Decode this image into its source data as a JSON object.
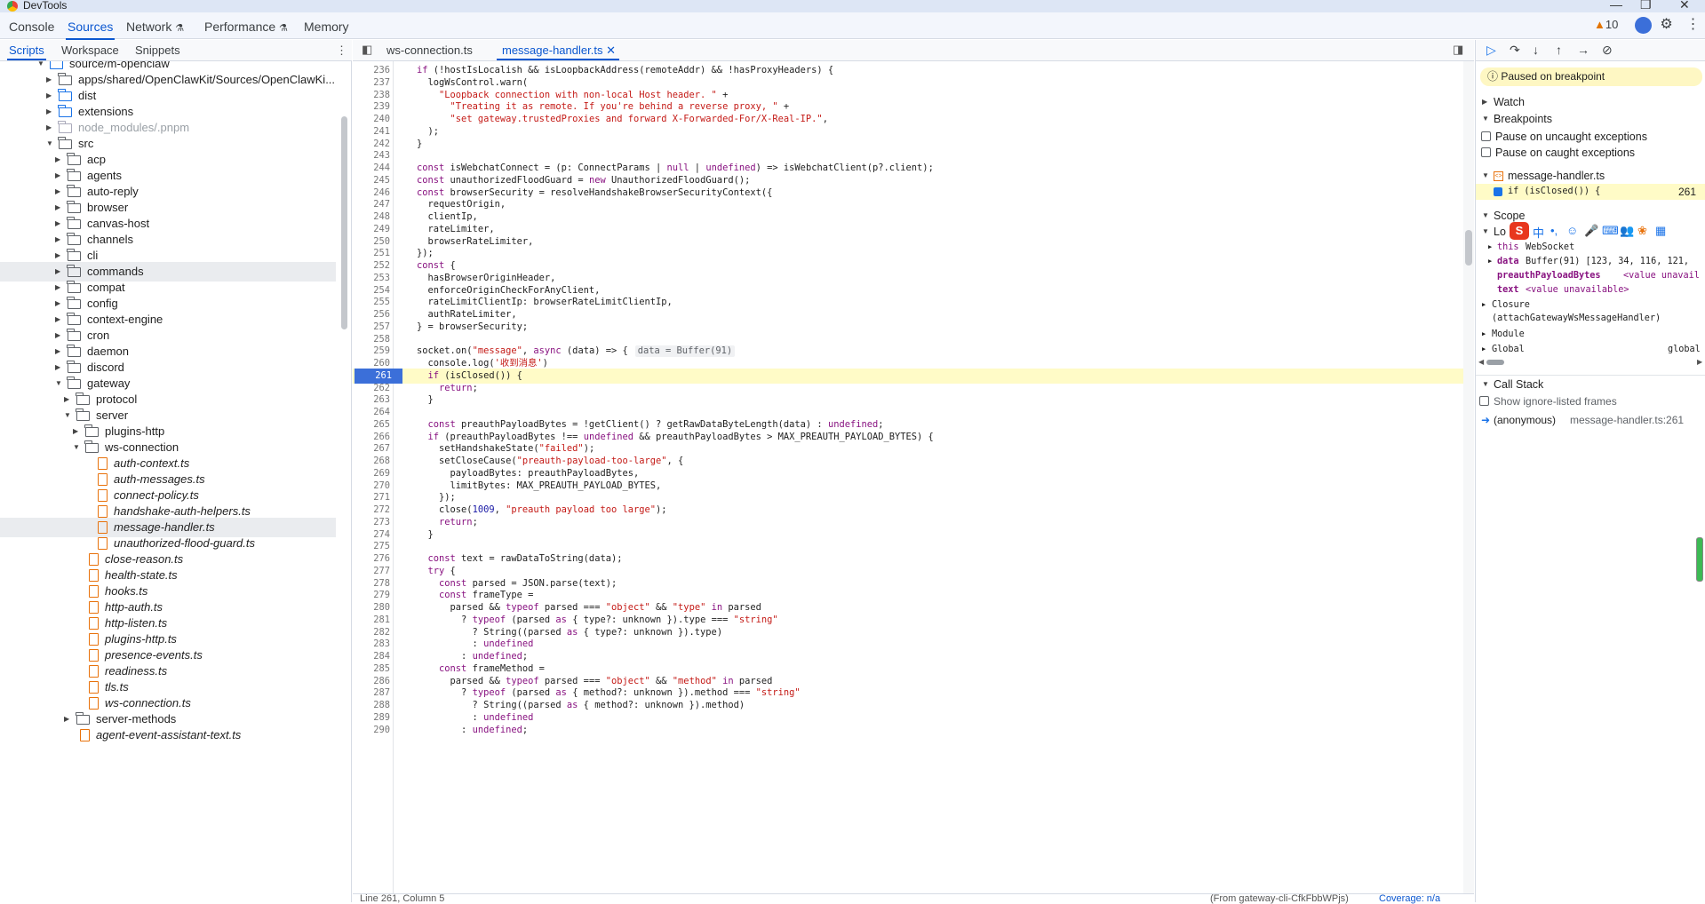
{
  "window": {
    "title": "DevTools"
  },
  "main_tabs": [
    "Console",
    "Sources",
    "Network",
    "Performance",
    "Memory"
  ],
  "issues_count": "10",
  "navigator": {
    "tabs": [
      "Scripts",
      "Workspace",
      "Snippets"
    ],
    "tree": [
      {
        "label": "source/m-openclaw",
        "type": "folder",
        "depth": 2,
        "open": true,
        "color": "blue"
      },
      {
        "label": "apps/shared/OpenClawKit/Sources/OpenClawKi...",
        "type": "folder",
        "depth": 3,
        "open": false
      },
      {
        "label": "dist",
        "type": "folder",
        "depth": 3,
        "open": false,
        "color": "blue"
      },
      {
        "label": "extensions",
        "type": "folder",
        "depth": 3,
        "open": false,
        "color": "blue"
      },
      {
        "label": "node_modules/.pnpm",
        "type": "folder",
        "depth": 3,
        "open": false,
        "color": "gray",
        "dim": true
      },
      {
        "label": "src",
        "type": "folder",
        "depth": 3,
        "open": true
      },
      {
        "label": "acp",
        "type": "folder",
        "depth": 4
      },
      {
        "label": "agents",
        "type": "folder",
        "depth": 4
      },
      {
        "label": "auto-reply",
        "type": "folder",
        "depth": 4
      },
      {
        "label": "browser",
        "type": "folder",
        "depth": 4
      },
      {
        "label": "canvas-host",
        "type": "folder",
        "depth": 4
      },
      {
        "label": "channels",
        "type": "folder",
        "depth": 4
      },
      {
        "label": "cli",
        "type": "folder",
        "depth": 4
      },
      {
        "label": "commands",
        "type": "folder",
        "depth": 4,
        "selected": true
      },
      {
        "label": "compat",
        "type": "folder",
        "depth": 4
      },
      {
        "label": "config",
        "type": "folder",
        "depth": 4
      },
      {
        "label": "context-engine",
        "type": "folder",
        "depth": 4
      },
      {
        "label": "cron",
        "type": "folder",
        "depth": 4
      },
      {
        "label": "daemon",
        "type": "folder",
        "depth": 4
      },
      {
        "label": "discord",
        "type": "folder",
        "depth": 4
      },
      {
        "label": "gateway",
        "type": "folder",
        "depth": 4,
        "open": true
      },
      {
        "label": "protocol",
        "type": "folder",
        "depth": 5
      },
      {
        "label": "server",
        "type": "folder",
        "depth": 5,
        "open": true
      },
      {
        "label": "plugins-http",
        "type": "folder",
        "depth": 6
      },
      {
        "label": "ws-connection",
        "type": "folder",
        "depth": 6,
        "open": true
      },
      {
        "label": "auth-context.ts",
        "type": "file",
        "depth": 7
      },
      {
        "label": "auth-messages.ts",
        "type": "file",
        "depth": 7
      },
      {
        "label": "connect-policy.ts",
        "type": "file",
        "depth": 7
      },
      {
        "label": "handshake-auth-helpers.ts",
        "type": "file",
        "depth": 7
      },
      {
        "label": "message-handler.ts",
        "type": "file",
        "depth": 7,
        "selected": true
      },
      {
        "label": "unauthorized-flood-guard.ts",
        "type": "file",
        "depth": 7
      },
      {
        "label": "close-reason.ts",
        "type": "file",
        "depth": 6
      },
      {
        "label": "health-state.ts",
        "type": "file",
        "depth": 6
      },
      {
        "label": "hooks.ts",
        "type": "file",
        "depth": 6
      },
      {
        "label": "http-auth.ts",
        "type": "file",
        "depth": 6
      },
      {
        "label": "http-listen.ts",
        "type": "file",
        "depth": 6
      },
      {
        "label": "plugins-http.ts",
        "type": "file",
        "depth": 6
      },
      {
        "label": "presence-events.ts",
        "type": "file",
        "depth": 6
      },
      {
        "label": "readiness.ts",
        "type": "file",
        "depth": 6
      },
      {
        "label": "tls.ts",
        "type": "file",
        "depth": 6
      },
      {
        "label": "ws-connection.ts",
        "type": "file",
        "depth": 6
      },
      {
        "label": "server-methods",
        "type": "folder",
        "depth": 5
      },
      {
        "label": "agent-event-assistant-text.ts",
        "type": "file",
        "depth": 5
      }
    ]
  },
  "editor": {
    "tabs": [
      "ws-connection.ts",
      "message-handler.ts"
    ],
    "active_tab": "message-handler.ts",
    "breakpoint_line": 261,
    "lines": [
      {
        "n": 236,
        "t": "if (!hostIsLocalish && isLoopbackAddress(remoteAddr) && !hasProxyHeaders) {"
      },
      {
        "n": 237,
        "t": "  logWsControl.warn("
      },
      {
        "n": 238,
        "t": "    \"Loopback connection with non-local Host header. \" +"
      },
      {
        "n": 239,
        "t": "      \"Treating it as remote. If you're behind a reverse proxy, \" +"
      },
      {
        "n": 240,
        "t": "      \"set gateway.trustedProxies and forward X-Forwarded-For/X-Real-IP.\","
      },
      {
        "n": 241,
        "t": "  );"
      },
      {
        "n": 242,
        "t": "}"
      },
      {
        "n": 243,
        "t": ""
      },
      {
        "n": 244,
        "t": "const isWebchatConnect = (p: ConnectParams | null | undefined) => isWebchatClient(p?.client);"
      },
      {
        "n": 245,
        "t": "const unauthorizedFloodGuard = new UnauthorizedFloodGuard();"
      },
      {
        "n": 246,
        "t": "const browserSecurity = resolveHandshakeBrowserSecurityContext({"
      },
      {
        "n": 247,
        "t": "  requestOrigin,"
      },
      {
        "n": 248,
        "t": "  clientIp,"
      },
      {
        "n": 249,
        "t": "  rateLimiter,"
      },
      {
        "n": 250,
        "t": "  browserRateLimiter,"
      },
      {
        "n": 251,
        "t": "});"
      },
      {
        "n": 252,
        "t": "const {"
      },
      {
        "n": 253,
        "t": "  hasBrowserOriginHeader,"
      },
      {
        "n": 254,
        "t": "  enforceOriginCheckForAnyClient,"
      },
      {
        "n": 255,
        "t": "  rateLimitClientIp: browserRateLimitClientIp,"
      },
      {
        "n": 256,
        "t": "  authRateLimiter,"
      },
      {
        "n": 257,
        "t": "} = browserSecurity;"
      },
      {
        "n": 258,
        "t": ""
      },
      {
        "n": 259,
        "t": "socket.on(\"message\", async (data) => {",
        "inline": "data = Buffer(91)"
      },
      {
        "n": 260,
        "t": "  console.log('收到消息')"
      },
      {
        "n": 261,
        "t": "  if (isClosed()) {"
      },
      {
        "n": 262,
        "t": "    return;"
      },
      {
        "n": 263,
        "t": "  }"
      },
      {
        "n": 264,
        "t": ""
      },
      {
        "n": 265,
        "t": "  const preauthPayloadBytes = !getClient() ? getRawDataByteLength(data) : undefined;"
      },
      {
        "n": 266,
        "t": "  if (preauthPayloadBytes !== undefined && preauthPayloadBytes > MAX_PREAUTH_PAYLOAD_BYTES) {"
      },
      {
        "n": 267,
        "t": "    setHandshakeState(\"failed\");"
      },
      {
        "n": 268,
        "t": "    setCloseCause(\"preauth-payload-too-large\", {"
      },
      {
        "n": 269,
        "t": "      payloadBytes: preauthPayloadBytes,"
      },
      {
        "n": 270,
        "t": "      limitBytes: MAX_PREAUTH_PAYLOAD_BYTES,"
      },
      {
        "n": 271,
        "t": "    });"
      },
      {
        "n": 272,
        "t": "    close(1009, \"preauth payload too large\");"
      },
      {
        "n": 273,
        "t": "    return;"
      },
      {
        "n": 274,
        "t": "  }"
      },
      {
        "n": 275,
        "t": ""
      },
      {
        "n": 276,
        "t": "  const text = rawDataToString(data);"
      },
      {
        "n": 277,
        "t": "  try {"
      },
      {
        "n": 278,
        "t": "    const parsed = JSON.parse(text);"
      },
      {
        "n": 279,
        "t": "    const frameType ="
      },
      {
        "n": 280,
        "t": "      parsed && typeof parsed === \"object\" && \"type\" in parsed"
      },
      {
        "n": 281,
        "t": "        ? typeof (parsed as { type?: unknown }).type === \"string\""
      },
      {
        "n": 282,
        "t": "          ? String((parsed as { type?: unknown }).type)"
      },
      {
        "n": 283,
        "t": "          : undefined"
      },
      {
        "n": 284,
        "t": "        : undefined;"
      },
      {
        "n": 285,
        "t": "    const frameMethod ="
      },
      {
        "n": 286,
        "t": "      parsed && typeof parsed === \"object\" && \"method\" in parsed"
      },
      {
        "n": 287,
        "t": "        ? typeof (parsed as { method?: unknown }).method === \"string\""
      },
      {
        "n": 288,
        "t": "          ? String((parsed as { method?: unknown }).method)"
      },
      {
        "n": 289,
        "t": "          : undefined"
      },
      {
        "n": 290,
        "t": "        : undefined;"
      }
    ],
    "status_left": "Line 261, Column 5",
    "status_right": "(From gateway-cli-CfkFbbWPjs)",
    "coverage": "Coverage: n/a"
  },
  "debugger": {
    "paused_text": "Paused on breakpoint",
    "sections": {
      "watch": "Watch",
      "breakpoints": "Breakpoints",
      "scope": "Scope",
      "call_stack": "Call Stack"
    },
    "pause_uncaught": "Pause on uncaught exceptions",
    "pause_caught": "Pause on caught exceptions",
    "bp_file": "message-handler.ts",
    "bp_code": "if (isClosed()) {",
    "bp_line": "261",
    "scope_local": "Lo",
    "scope_items": [
      {
        "key": "this",
        "value": "WebSocket"
      },
      {
        "key": "data",
        "value": "Buffer(91)  [123, 34, 116, 121,"
      },
      {
        "key": "preauthPayloadBytes",
        "value": "<value unavail"
      },
      {
        "key": "text",
        "value": "<value unavailable>"
      }
    ],
    "closure": "Closure",
    "closure_fn": "(attachGatewayWsMessageHandler)",
    "module": "Module",
    "global": "Global",
    "global_val": "global",
    "show_ignore": "Show ignore-listed frames",
    "frame_name": "(anonymous)",
    "frame_loc": "message-handler.ts:261"
  },
  "colors": {
    "accent": "#0b57d0",
    "highlight": "#fffbc7",
    "breakpoint": "#3b6fd9"
  }
}
